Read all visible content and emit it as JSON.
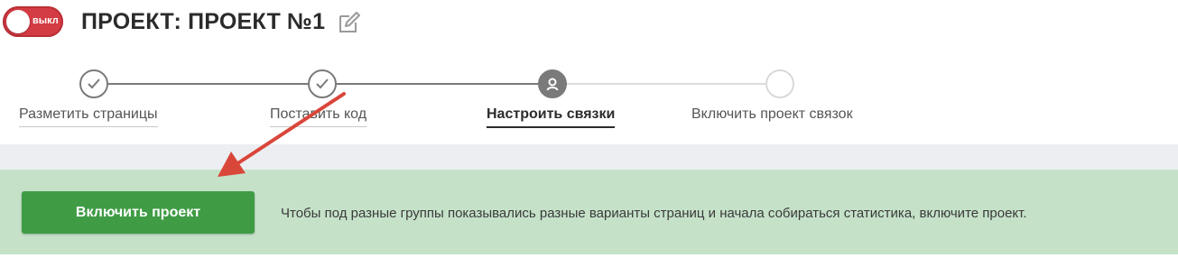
{
  "header": {
    "toggle_label": "выкл",
    "title": "ПРОЕКТ: ПРОЕКТ №1"
  },
  "stepper": {
    "steps": [
      {
        "label": "Разметить страницы",
        "state": "done"
      },
      {
        "label": "Поставить код",
        "state": "done"
      },
      {
        "label": "Настроить связки",
        "state": "active"
      },
      {
        "label": "Включить проект связок",
        "state": "todo"
      }
    ]
  },
  "panel": {
    "enable_button_label": "Включить проект",
    "hint_text": "Чтобы под разные группы показывались разные варианты страниц и начала собираться статистика, включите проект."
  },
  "colors": {
    "toggle_off": "#d43c44",
    "stepper_done": "#7a7a7a",
    "panel_bg": "#c5e2c9",
    "button_green": "#3f9c45",
    "annotation_arrow": "#d9463a"
  },
  "icons": {
    "edit": "pencil-square-icon",
    "done": "check-icon",
    "active": "user-icon"
  }
}
